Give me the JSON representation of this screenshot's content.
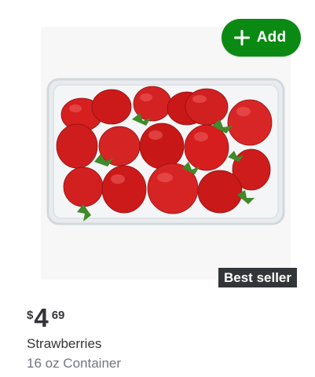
{
  "add_button": {
    "label": "Add",
    "icon": "plus-icon",
    "color": "#0a8a13"
  },
  "badge": {
    "text": "Best seller",
    "color": "#343538"
  },
  "price": {
    "currency": "$",
    "dollars": "4",
    "cents": "69"
  },
  "product": {
    "name": "Strawberries",
    "size": "16 oz Container",
    "image": "strawberries-container-image"
  }
}
